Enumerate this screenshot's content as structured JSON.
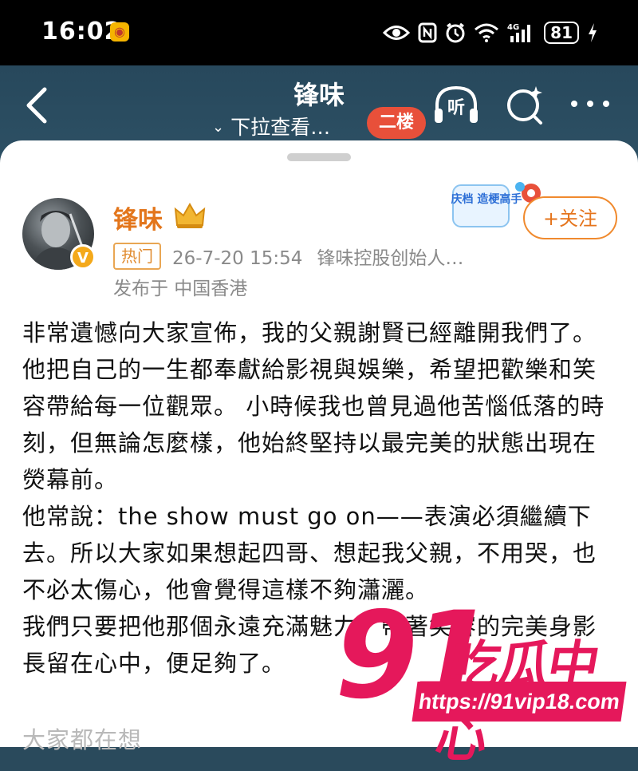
{
  "status_bar": {
    "time": "16:02",
    "battery": "81",
    "network": "4G",
    "icons": [
      "eye-icon",
      "nfc-icon",
      "alarm-icon",
      "wifi-icon",
      "signal-icon",
      "battery-icon",
      "charging-icon"
    ]
  },
  "nav": {
    "title": "锋味",
    "subtitle": "下拉查看…",
    "floor_badge": "二楼",
    "listen_label": "听",
    "accent_color": "#e8503a"
  },
  "post": {
    "username": "锋味",
    "tag": "热门",
    "timestamp": "26-7-20 15:54",
    "source": "锋味控股创始人…",
    "location": "发布于 中国香港",
    "follow_label": "+关注",
    "promo_text": "国庆档 造梗高手",
    "name_color": "#e3761c",
    "paragraphs": [
      "非常遺憾向大家宣佈，我的父親謝賢已經離開我們了。",
      "他把自己的一生都奉獻給影視與娛樂，希望把歡樂和笑容帶給每一位觀眾。 小時候我也曾見過他苦惱低落的時刻，但無論怎麼樣，他始終堅持以最完美的狀態出現在熒幕前。",
      "他常說：the show must go on——表演必須繼續下去。所以大家如果想起四哥、想起我父親，不用哭，也不必太傷心，他會覺得這樣不夠瀟灑。",
      "我們只要把他那個永遠充滿魅力、帶著笑容的完美身影長留在心中，便足夠了。"
    ],
    "truncated_next": "大家都在想"
  },
  "watermark": {
    "number": "91",
    "name": "吃瓜中心",
    "url": "https://91vip18.com",
    "color": "#e5185b"
  }
}
